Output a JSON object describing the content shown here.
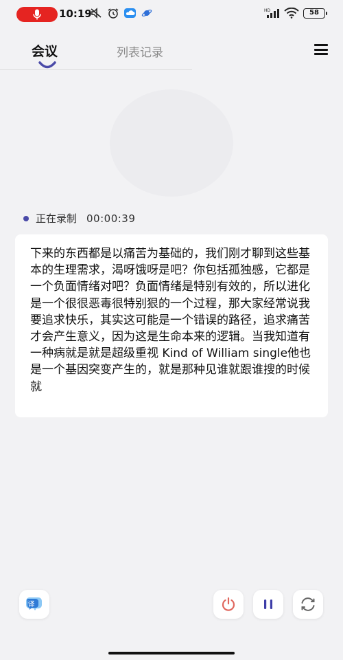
{
  "status_bar": {
    "time": "10:19",
    "battery": "58",
    "icons": [
      "mic-icon",
      "mute-icon",
      "alarm-icon",
      "cloud-icon",
      "planet-icon",
      "signal-hd-icon",
      "wifi-icon",
      "battery-icon"
    ]
  },
  "tabs": [
    {
      "label": "会议",
      "active": true
    },
    {
      "label": "列表记录",
      "active": false
    }
  ],
  "recording": {
    "status_label": "正在录制",
    "elapsed": "00:00:39"
  },
  "transcript": {
    "text": "下来的东西都是以痛苦为基础的，我们刚才聊到这些基本的生理需求，渴呀饿呀是吧？你包括孤独感，它都是一个负面情绪对吧？负面情绪是特别有效的，所以进化是一个很很恶毒很特别狠的一个过程，那大家经常说我要追求快乐，其实这可能是一个错误的路径，追求痛苦才会产生意义，因为这是生命本来的逻辑。当我知道有一种病就是就是超级重视 Kind of William single他也是一个基因突变产生的，就是那种见谁就跟谁搜的时候就"
  },
  "controls": {
    "translate_glyph": "译",
    "icons": [
      "translate-icon",
      "power-icon",
      "pause-icon",
      "refresh-icon"
    ]
  },
  "colors": {
    "accent": "#4a4aa8",
    "mic_pill": "#e52421",
    "power": "#e0675e",
    "pause": "#3d3da8"
  }
}
